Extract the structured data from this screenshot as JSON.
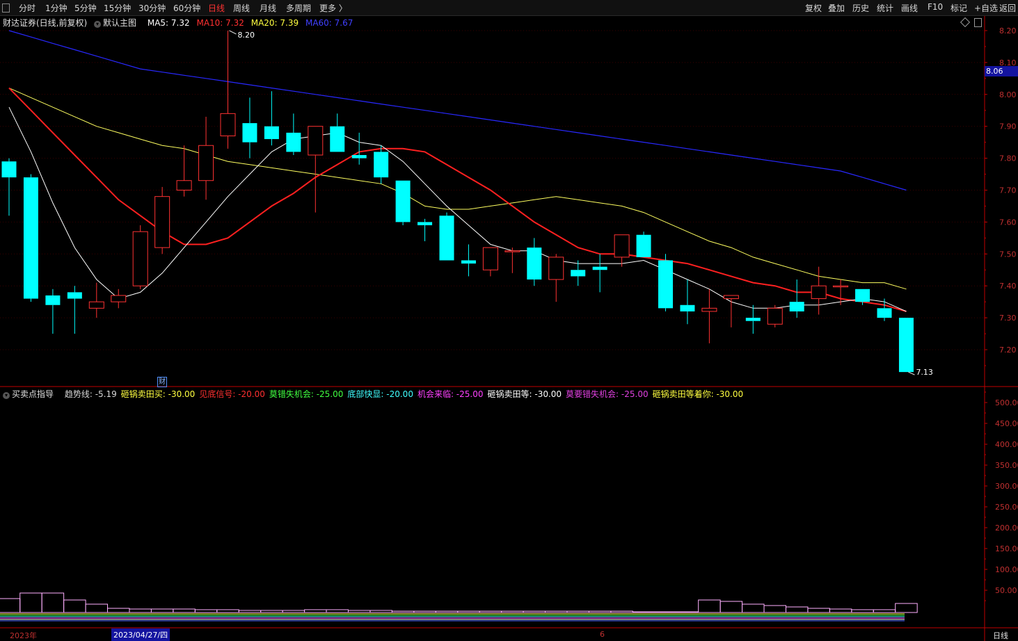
{
  "toolbar": {
    "periods": [
      "分时",
      "1分钟",
      "5分钟",
      "15分钟",
      "30分钟",
      "60分钟",
      "日线",
      "周线",
      "月线",
      "多周期",
      "更多 〉"
    ],
    "active_period": "日线",
    "tools": [
      "复权",
      "叠加",
      "历史",
      "统计",
      "画线",
      "F10",
      "标记",
      "+自选",
      "返回"
    ]
  },
  "main_info": {
    "stock": "财达证券(日线,前复权)",
    "template": "默认主图",
    "ma5": "MA5: 7.32",
    "ma10": "MA10: 7.32",
    "ma20": "MA20: 7.39",
    "ma60": "MA60: 7.67"
  },
  "indicator_info": {
    "name": "买卖点指导",
    "items": [
      {
        "label": "趋势线: -5.19",
        "color": "#d8d8d8"
      },
      {
        "label": "砸锅卖田买: -30.00",
        "color": "#ffff40"
      },
      {
        "label": "见底信号: -20.00",
        "color": "#ff3030"
      },
      {
        "label": "莫错失机会: -25.00",
        "color": "#40ff40"
      },
      {
        "label": "底部快显: -20.00",
        "color": "#40ffff"
      },
      {
        "label": "机会来临: -25.00",
        "color": "#ff40ff"
      },
      {
        "label": "砸锅卖田等: -30.00",
        "color": "#ffffff"
      },
      {
        "label": "莫要错失机会: -25.00",
        "color": "#e040e0"
      },
      {
        "label": "砸锅卖田等着你: -30.00",
        "color": "#ffff40"
      }
    ]
  },
  "current_price_tag": "8.06",
  "date_bar": {
    "year_label": "2023年",
    "cursor_date": "2023/04/27/四",
    "month_label": "6",
    "period_label": "日线"
  },
  "event_marker": "财",
  "colors": {
    "up": "#ff3232",
    "down": "#00ffff",
    "ma5": "#ffffff",
    "ma10": "#ff2020",
    "ma20": "#ffff60",
    "ma60": "#2828ff",
    "axis": "#c00000"
  },
  "chart_data": {
    "type": "candlestick",
    "price_axis": {
      "ylim": [
        7.1,
        8.23
      ],
      "ticks": [
        8.2,
        8.1,
        8.0,
        7.9,
        7.8,
        7.7,
        7.6,
        7.5,
        7.4,
        7.3,
        7.2
      ]
    },
    "high_label": "8.20",
    "low_label": "7.13",
    "candles": [
      {
        "o": 7.79,
        "h": 7.8,
        "l": 7.62,
        "c": 7.74
      },
      {
        "o": 7.74,
        "h": 7.75,
        "l": 7.35,
        "c": 7.36
      },
      {
        "o": 7.37,
        "h": 7.39,
        "l": 7.25,
        "c": 7.34
      },
      {
        "o": 7.38,
        "h": 7.4,
        "l": 7.25,
        "c": 7.36
      },
      {
        "o": 7.33,
        "h": 7.41,
        "l": 7.3,
        "c": 7.35
      },
      {
        "o": 7.35,
        "h": 7.39,
        "l": 7.33,
        "c": 7.37
      },
      {
        "o": 7.4,
        "h": 7.59,
        "l": 7.39,
        "c": 7.57
      },
      {
        "o": 7.52,
        "h": 7.71,
        "l": 7.5,
        "c": 7.68
      },
      {
        "o": 7.7,
        "h": 7.84,
        "l": 7.68,
        "c": 7.73
      },
      {
        "o": 7.73,
        "h": 7.93,
        "l": 7.67,
        "c": 7.84
      },
      {
        "o": 7.87,
        "h": 8.2,
        "l": 7.83,
        "c": 7.94
      },
      {
        "o": 7.91,
        "h": 7.99,
        "l": 7.8,
        "c": 7.85
      },
      {
        "o": 7.9,
        "h": 8.01,
        "l": 7.84,
        "c": 7.86
      },
      {
        "o": 7.88,
        "h": 7.94,
        "l": 7.81,
        "c": 7.82
      },
      {
        "o": 7.81,
        "h": 7.9,
        "l": 7.63,
        "c": 7.9
      },
      {
        "o": 7.9,
        "h": 7.94,
        "l": 7.82,
        "c": 7.82
      },
      {
        "o": 7.81,
        "h": 7.88,
        "l": 7.78,
        "c": 7.8
      },
      {
        "o": 7.82,
        "h": 7.84,
        "l": 7.72,
        "c": 7.74
      },
      {
        "o": 7.73,
        "h": 7.73,
        "l": 7.59,
        "c": 7.6
      },
      {
        "o": 7.6,
        "h": 7.61,
        "l": 7.54,
        "c": 7.59
      },
      {
        "o": 7.62,
        "h": 7.63,
        "l": 7.48,
        "c": 7.48
      },
      {
        "o": 7.48,
        "h": 7.53,
        "l": 7.43,
        "c": 7.47
      },
      {
        "o": 7.45,
        "h": 7.52,
        "l": 7.43,
        "c": 7.52
      },
      {
        "o": 7.51,
        "h": 7.52,
        "l": 7.44,
        "c": 7.51
      },
      {
        "o": 7.52,
        "h": 7.55,
        "l": 7.4,
        "c": 7.42
      },
      {
        "o": 7.42,
        "h": 7.5,
        "l": 7.35,
        "c": 7.49
      },
      {
        "o": 7.45,
        "h": 7.48,
        "l": 7.4,
        "c": 7.43
      },
      {
        "o": 7.46,
        "h": 7.5,
        "l": 7.38,
        "c": 7.45
      },
      {
        "o": 7.49,
        "h": 7.56,
        "l": 7.46,
        "c": 7.56
      },
      {
        "o": 7.56,
        "h": 7.57,
        "l": 7.49,
        "c": 7.49
      },
      {
        "o": 7.48,
        "h": 7.5,
        "l": 7.32,
        "c": 7.33
      },
      {
        "o": 7.34,
        "h": 7.42,
        "l": 7.28,
        "c": 7.32
      },
      {
        "o": 7.32,
        "h": 7.39,
        "l": 7.22,
        "c": 7.33
      },
      {
        "o": 7.36,
        "h": 7.37,
        "l": 7.27,
        "c": 7.37
      },
      {
        "o": 7.3,
        "h": 7.34,
        "l": 7.25,
        "c": 7.29
      },
      {
        "o": 7.28,
        "h": 7.34,
        "l": 7.27,
        "c": 7.33
      },
      {
        "o": 7.35,
        "h": 7.42,
        "l": 7.3,
        "c": 7.32
      },
      {
        "o": 7.36,
        "h": 7.46,
        "l": 7.31,
        "c": 7.4
      },
      {
        "o": 7.4,
        "h": 7.42,
        "l": 7.34,
        "c": 7.4
      },
      {
        "o": 7.39,
        "h": 7.39,
        "l": 7.34,
        "c": 7.35
      },
      {
        "o": 7.33,
        "h": 7.36,
        "l": 7.29,
        "c": 7.3
      },
      {
        "o": 7.3,
        "h": 7.3,
        "l": 7.13,
        "c": 7.13
      }
    ],
    "ma5": [
      7.96,
      7.82,
      7.66,
      7.52,
      7.42,
      7.36,
      7.38,
      7.44,
      7.52,
      7.6,
      7.68,
      7.75,
      7.82,
      7.86,
      7.87,
      7.88,
      7.85,
      7.84,
      7.79,
      7.72,
      7.65,
      7.59,
      7.53,
      7.51,
      7.51,
      7.48,
      7.47,
      7.47,
      7.47,
      7.48,
      7.45,
      7.42,
      7.39,
      7.35,
      7.33,
      7.33,
      7.34,
      7.34,
      7.35,
      7.36,
      7.35,
      7.32
    ],
    "ma10": [
      8.02,
      7.95,
      7.88,
      7.81,
      7.74,
      7.67,
      7.62,
      7.57,
      7.53,
      7.53,
      7.55,
      7.6,
      7.65,
      7.69,
      7.74,
      7.78,
      7.82,
      7.83,
      7.83,
      7.82,
      7.78,
      7.74,
      7.7,
      7.65,
      7.6,
      7.56,
      7.52,
      7.5,
      7.5,
      7.49,
      7.48,
      7.47,
      7.45,
      7.43,
      7.41,
      7.4,
      7.38,
      7.38,
      7.36,
      7.35,
      7.34,
      7.32
    ],
    "ma20": [
      8.02,
      7.99,
      7.96,
      7.93,
      7.9,
      7.88,
      7.86,
      7.84,
      7.83,
      7.81,
      7.79,
      7.78,
      7.77,
      7.76,
      7.75,
      7.74,
      7.73,
      7.72,
      7.69,
      7.65,
      7.64,
      7.64,
      7.65,
      7.66,
      7.67,
      7.68,
      7.67,
      7.66,
      7.65,
      7.63,
      7.6,
      7.57,
      7.54,
      7.52,
      7.49,
      7.47,
      7.45,
      7.43,
      7.42,
      7.41,
      7.41,
      7.39
    ],
    "ma60": [
      8.2,
      8.18,
      8.16,
      8.14,
      8.12,
      8.1,
      8.08,
      8.07,
      8.06,
      8.05,
      8.04,
      8.03,
      8.02,
      8.01,
      8.0,
      7.99,
      7.98,
      7.97,
      7.96,
      7.95,
      7.94,
      7.93,
      7.92,
      7.91,
      7.9,
      7.89,
      7.88,
      7.87,
      7.86,
      7.85,
      7.84,
      7.83,
      7.82,
      7.81,
      7.8,
      7.79,
      7.78,
      7.77,
      7.76,
      7.74,
      7.72,
      7.7
    ],
    "indicator_axis": {
      "ticks": [
        500.0,
        450.0,
        400.0,
        350.0,
        300.0,
        250.0,
        200.0,
        150.0,
        100.0,
        50.0
      ]
    },
    "volume": [
      20,
      28,
      28,
      18,
      12,
      6,
      5,
      5,
      5,
      4,
      4,
      3,
      3,
      3,
      4,
      4,
      3,
      3,
      2,
      2,
      2,
      2,
      2,
      2,
      2,
      2,
      2,
      2,
      2,
      1,
      1,
      1,
      18,
      16,
      12,
      10,
      8,
      6,
      5,
      4,
      4,
      13
    ]
  }
}
